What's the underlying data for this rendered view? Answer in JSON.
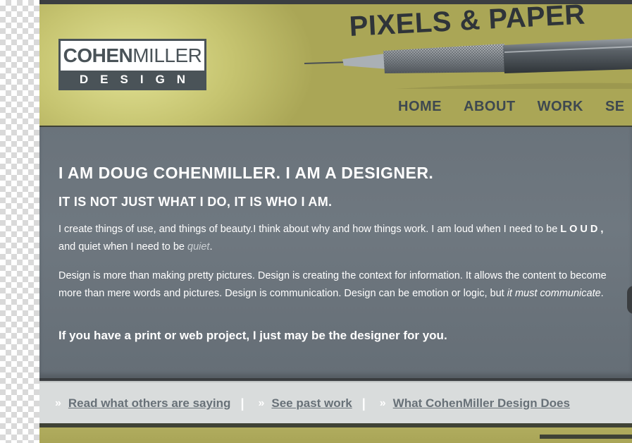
{
  "logo": {
    "top_bold": "COHEN",
    "top_regular": "MILLER",
    "bottom": "DESIGN"
  },
  "header": {
    "tagline": "PIXELS & PAPER"
  },
  "nav": {
    "items": [
      "HOME",
      "ABOUT",
      "WORK",
      "SE"
    ]
  },
  "main": {
    "heading": "I AM DOUG COHENMILLER. I AM A DESIGNER.",
    "subheading": "IT IS NOT JUST WHAT I DO, IT IS WHO I AM.",
    "p1_start": "I create things of use, and things of beauty.I think about why and how things work. I am loud when I need to be ",
    "p1_loud": "LOUD,",
    "p1_mid": " and quiet when I need to be ",
    "p1_quiet": "quiet",
    "p1_end": ".",
    "p2_start": "Design is more than making pretty pictures. Design is creating the context for information. It allows the content to become more than mere words and pictures. Design is communication. Design can be emotion or logic, but ",
    "p2_italic": "it must communicate",
    "p2_end": ".",
    "cta": "If you have a print or web project, I just may be the designer for you."
  },
  "links": {
    "chevron": "»",
    "separator": "|",
    "items": [
      "Read what others are saying",
      "See past work",
      "What CohenMiller Design Does"
    ]
  },
  "colors": {
    "header_bg": "#c6c470",
    "main_bg": "#6f7880",
    "links_bg": "#d9dcdc",
    "logo_dark": "#4a5358",
    "nav_text": "#3e4850"
  },
  "icons": {
    "pen": "mechanical-pencil-illustration"
  }
}
